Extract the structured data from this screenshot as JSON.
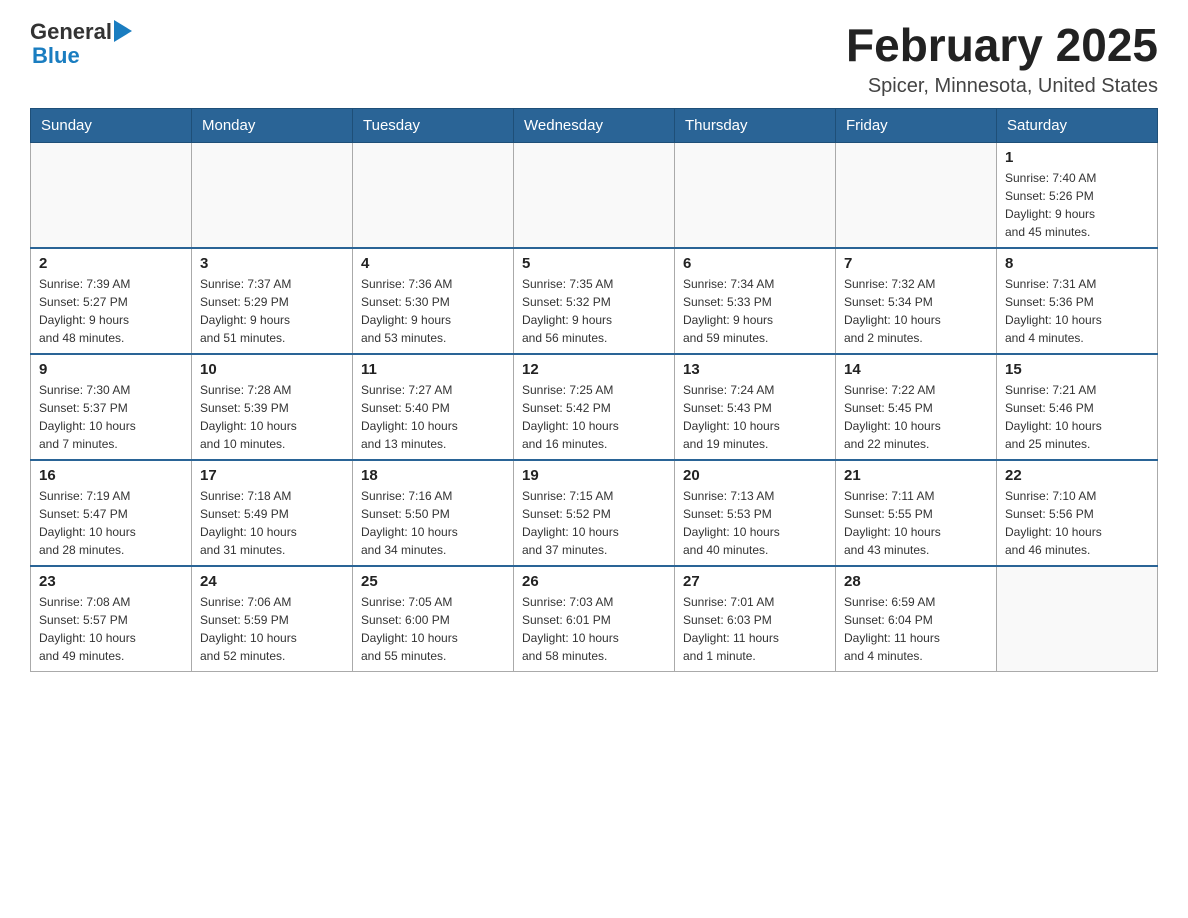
{
  "header": {
    "logo_text_general": "General",
    "logo_text_blue": "Blue",
    "month_title": "February 2025",
    "subtitle": "Spicer, Minnesota, United States"
  },
  "calendar": {
    "days_of_week": [
      "Sunday",
      "Monday",
      "Tuesday",
      "Wednesday",
      "Thursday",
      "Friday",
      "Saturday"
    ],
    "weeks": [
      [
        {
          "day": "",
          "info": ""
        },
        {
          "day": "",
          "info": ""
        },
        {
          "day": "",
          "info": ""
        },
        {
          "day": "",
          "info": ""
        },
        {
          "day": "",
          "info": ""
        },
        {
          "day": "",
          "info": ""
        },
        {
          "day": "1",
          "info": "Sunrise: 7:40 AM\nSunset: 5:26 PM\nDaylight: 9 hours\nand 45 minutes."
        }
      ],
      [
        {
          "day": "2",
          "info": "Sunrise: 7:39 AM\nSunset: 5:27 PM\nDaylight: 9 hours\nand 48 minutes."
        },
        {
          "day": "3",
          "info": "Sunrise: 7:37 AM\nSunset: 5:29 PM\nDaylight: 9 hours\nand 51 minutes."
        },
        {
          "day": "4",
          "info": "Sunrise: 7:36 AM\nSunset: 5:30 PM\nDaylight: 9 hours\nand 53 minutes."
        },
        {
          "day": "5",
          "info": "Sunrise: 7:35 AM\nSunset: 5:32 PM\nDaylight: 9 hours\nand 56 minutes."
        },
        {
          "day": "6",
          "info": "Sunrise: 7:34 AM\nSunset: 5:33 PM\nDaylight: 9 hours\nand 59 minutes."
        },
        {
          "day": "7",
          "info": "Sunrise: 7:32 AM\nSunset: 5:34 PM\nDaylight: 10 hours\nand 2 minutes."
        },
        {
          "day": "8",
          "info": "Sunrise: 7:31 AM\nSunset: 5:36 PM\nDaylight: 10 hours\nand 4 minutes."
        }
      ],
      [
        {
          "day": "9",
          "info": "Sunrise: 7:30 AM\nSunset: 5:37 PM\nDaylight: 10 hours\nand 7 minutes."
        },
        {
          "day": "10",
          "info": "Sunrise: 7:28 AM\nSunset: 5:39 PM\nDaylight: 10 hours\nand 10 minutes."
        },
        {
          "day": "11",
          "info": "Sunrise: 7:27 AM\nSunset: 5:40 PM\nDaylight: 10 hours\nand 13 minutes."
        },
        {
          "day": "12",
          "info": "Sunrise: 7:25 AM\nSunset: 5:42 PM\nDaylight: 10 hours\nand 16 minutes."
        },
        {
          "day": "13",
          "info": "Sunrise: 7:24 AM\nSunset: 5:43 PM\nDaylight: 10 hours\nand 19 minutes."
        },
        {
          "day": "14",
          "info": "Sunrise: 7:22 AM\nSunset: 5:45 PM\nDaylight: 10 hours\nand 22 minutes."
        },
        {
          "day": "15",
          "info": "Sunrise: 7:21 AM\nSunset: 5:46 PM\nDaylight: 10 hours\nand 25 minutes."
        }
      ],
      [
        {
          "day": "16",
          "info": "Sunrise: 7:19 AM\nSunset: 5:47 PM\nDaylight: 10 hours\nand 28 minutes."
        },
        {
          "day": "17",
          "info": "Sunrise: 7:18 AM\nSunset: 5:49 PM\nDaylight: 10 hours\nand 31 minutes."
        },
        {
          "day": "18",
          "info": "Sunrise: 7:16 AM\nSunset: 5:50 PM\nDaylight: 10 hours\nand 34 minutes."
        },
        {
          "day": "19",
          "info": "Sunrise: 7:15 AM\nSunset: 5:52 PM\nDaylight: 10 hours\nand 37 minutes."
        },
        {
          "day": "20",
          "info": "Sunrise: 7:13 AM\nSunset: 5:53 PM\nDaylight: 10 hours\nand 40 minutes."
        },
        {
          "day": "21",
          "info": "Sunrise: 7:11 AM\nSunset: 5:55 PM\nDaylight: 10 hours\nand 43 minutes."
        },
        {
          "day": "22",
          "info": "Sunrise: 7:10 AM\nSunset: 5:56 PM\nDaylight: 10 hours\nand 46 minutes."
        }
      ],
      [
        {
          "day": "23",
          "info": "Sunrise: 7:08 AM\nSunset: 5:57 PM\nDaylight: 10 hours\nand 49 minutes."
        },
        {
          "day": "24",
          "info": "Sunrise: 7:06 AM\nSunset: 5:59 PM\nDaylight: 10 hours\nand 52 minutes."
        },
        {
          "day": "25",
          "info": "Sunrise: 7:05 AM\nSunset: 6:00 PM\nDaylight: 10 hours\nand 55 minutes."
        },
        {
          "day": "26",
          "info": "Sunrise: 7:03 AM\nSunset: 6:01 PM\nDaylight: 10 hours\nand 58 minutes."
        },
        {
          "day": "27",
          "info": "Sunrise: 7:01 AM\nSunset: 6:03 PM\nDaylight: 11 hours\nand 1 minute."
        },
        {
          "day": "28",
          "info": "Sunrise: 6:59 AM\nSunset: 6:04 PM\nDaylight: 11 hours\nand 4 minutes."
        },
        {
          "day": "",
          "info": ""
        }
      ]
    ]
  }
}
